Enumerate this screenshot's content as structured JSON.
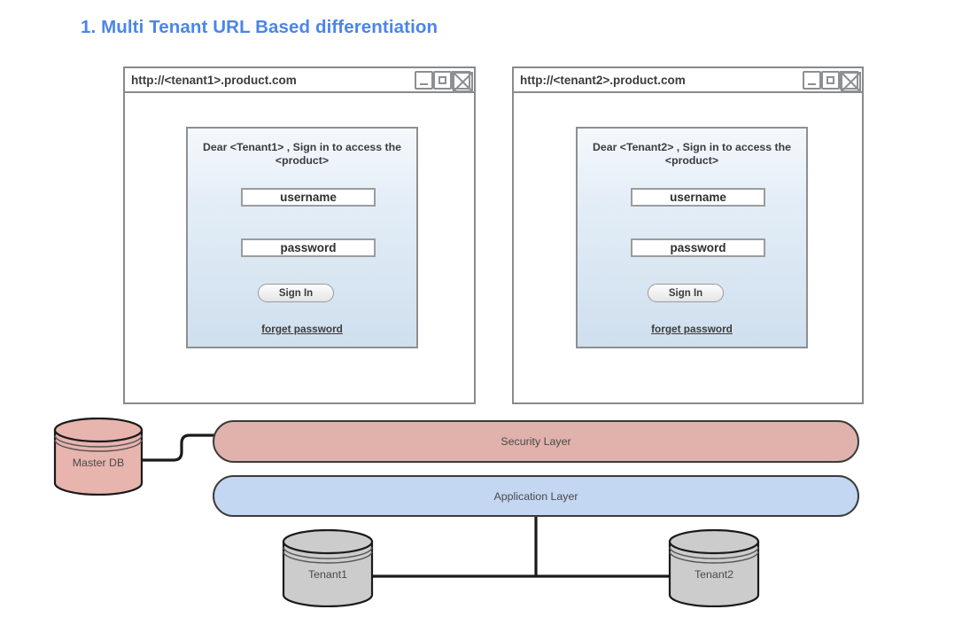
{
  "page": {
    "title": "1. Multi Tenant URL Based differentiation",
    "title_color": "#4a86e8",
    "background": "#ffffff"
  },
  "browsers": [
    {
      "url": "http://<tenant1>.product.com",
      "window_controls": [
        "minimize-icon",
        "maximize-icon",
        "close-icon"
      ],
      "login": {
        "greeting": "Dear <Tenant1> , Sign in to access the <product>",
        "username_value": "username",
        "password_value": "password",
        "signin_label": "Sign In",
        "forget_label": "forget password"
      }
    },
    {
      "url": "http://<tenant2>.product.com",
      "window_controls": [
        "minimize-icon",
        "maximize-icon",
        "close-icon"
      ],
      "login": {
        "greeting": "Dear <Tenant2> , Sign in to access the <product>",
        "username_value": "username",
        "password_value": "password",
        "signin_label": "Sign In",
        "forget_label": "forget password"
      }
    }
  ],
  "layers": [
    {
      "label": "Security Layer",
      "color": "#e0b2ab"
    },
    {
      "label": "Application Layer",
      "color": "#c3d6f2"
    }
  ],
  "databases": [
    {
      "label": "Master DB",
      "color": "#e8b4ae"
    },
    {
      "label": "Tenant1",
      "color": "#cccccc"
    },
    {
      "label": "Tenant2",
      "color": "#cccccc"
    }
  ]
}
